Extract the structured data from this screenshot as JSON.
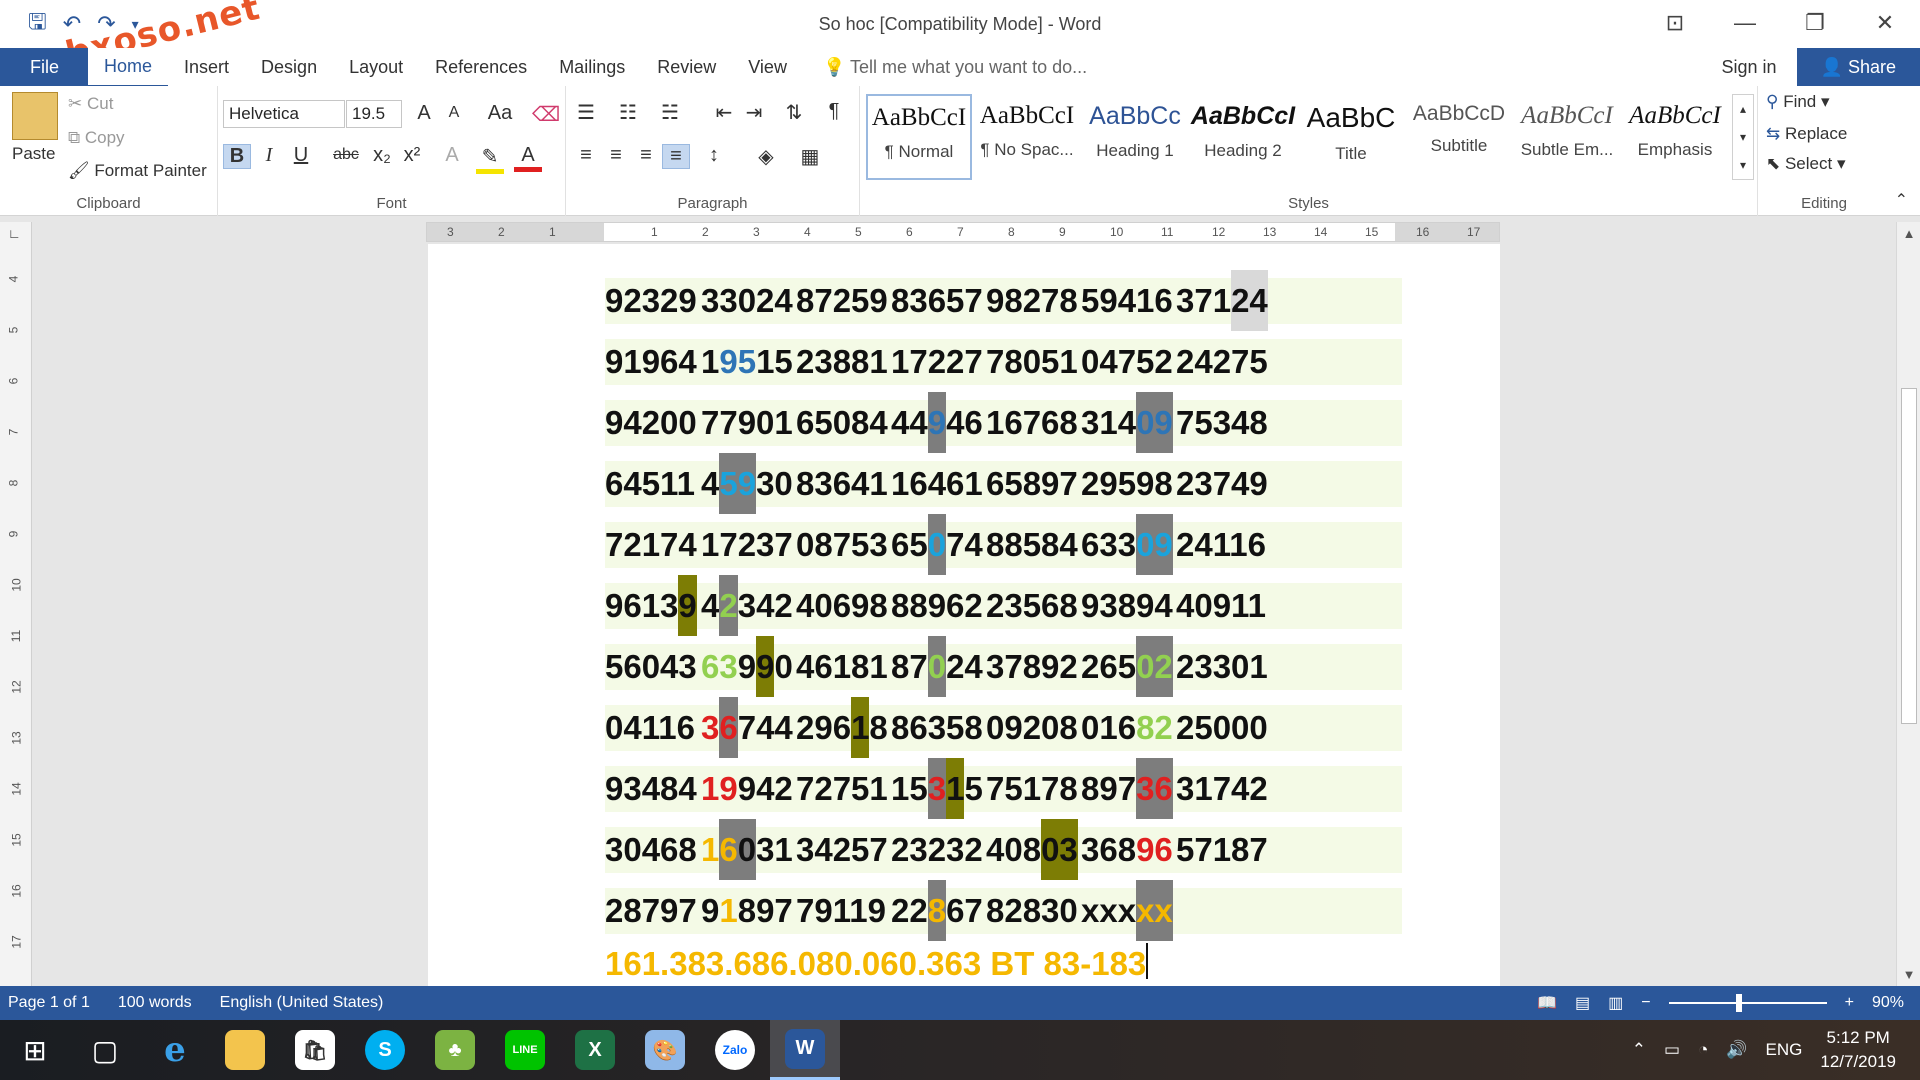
{
  "window": {
    "title": "So hoc [Compatibility Mode] - Word",
    "watermark": "webxoso.net",
    "controls": [
      "⊡",
      "—",
      "❐",
      "✕"
    ]
  },
  "ribbon_tabs": {
    "file": "File",
    "tabs": [
      "Home",
      "Insert",
      "Design",
      "Layout",
      "References",
      "Mailings",
      "Review",
      "View"
    ],
    "tell_me": "Tell me what you want to do...",
    "sign_in": "Sign in",
    "share": "Share"
  },
  "clipboard": {
    "paste": "Paste",
    "cut": "Cut",
    "copy": "Copy",
    "format_painter": "Format Painter",
    "label": "Clipboard"
  },
  "font": {
    "name": "Helvetica",
    "size": "19.5",
    "label": "Font",
    "bold": "B",
    "italic": "I",
    "underline": "U",
    "strike": "abc",
    "sub": "x₂",
    "sup": "x²",
    "case": "Aa"
  },
  "paragraph": {
    "label": "Paragraph",
    "pilcrow": "¶"
  },
  "styles": {
    "label": "Styles",
    "items": [
      {
        "sample": "AaBbCcI",
        "name": "¶ Normal"
      },
      {
        "sample": "AaBbCcI",
        "name": "¶ No Spac..."
      },
      {
        "sample": "AaBbCc",
        "name": "Heading 1"
      },
      {
        "sample": "AaBbCcI",
        "name": "Heading 2"
      },
      {
        "sample": "AaBbC",
        "name": "Title"
      },
      {
        "sample": "AaBbCcD",
        "name": "Subtitle"
      },
      {
        "sample": "AaBbCcI",
        "name": "Subtle Em..."
      },
      {
        "sample": "AaBbCcI",
        "name": "Emphasis"
      }
    ]
  },
  "editing": {
    "find": "Find",
    "replace": "Replace",
    "select": "Select",
    "label": "Editing"
  },
  "ruler": {
    "h_numbers": [
      "3",
      "2",
      "1",
      "",
      "1",
      "2",
      "3",
      "4",
      "5",
      "6",
      "7",
      "8",
      "9",
      "10",
      "11",
      "12",
      "13",
      "14",
      "15",
      "16",
      "17"
    ],
    "v_numbers": [
      "4",
      "5",
      "6",
      "7",
      "8",
      "9",
      "10",
      "11",
      "12",
      "13",
      "14",
      "15",
      "16",
      "17"
    ]
  },
  "document": {
    "rows": [
      [
        [
          [
            "92329",
            ""
          ]
        ],
        [
          [
            "33024",
            ""
          ]
        ],
        [
          [
            "87259",
            ""
          ]
        ],
        [
          [
            "83657",
            ""
          ]
        ],
        [
          [
            "98278",
            ""
          ]
        ],
        [
          [
            "59416",
            ""
          ]
        ],
        [
          [
            "371",
            ""
          ],
          [
            "2",
            "lt"
          ],
          [
            "4",
            "lt"
          ]
        ]
      ],
      [
        [
          [
            "91964",
            ""
          ]
        ],
        [
          [
            "1",
            ""
          ],
          [
            "95",
            "blue"
          ],
          [
            "15",
            ""
          ]
        ],
        [
          [
            "23881",
            ""
          ]
        ],
        [
          [
            "17227",
            ""
          ]
        ],
        [
          [
            "78051",
            ""
          ]
        ],
        [
          [
            "04752",
            ""
          ]
        ],
        [
          [
            "24275",
            ""
          ]
        ]
      ],
      [
        [
          [
            "94200",
            ""
          ]
        ],
        [
          [
            "77901",
            ""
          ]
        ],
        [
          [
            "65084",
            ""
          ]
        ],
        [
          [
            "44",
            ""
          ],
          [
            "9",
            "gray-blue"
          ],
          [
            "46",
            ""
          ]
        ],
        [
          [
            "16768",
            ""
          ]
        ],
        [
          [
            "314",
            ""
          ],
          [
            "09",
            "gray-blue"
          ]
        ],
        [
          [
            "75348",
            ""
          ]
        ]
      ],
      [
        [
          [
            "64511",
            ""
          ]
        ],
        [
          [
            "4",
            ""
          ],
          [
            "59",
            "gray-cyan"
          ],
          [
            "30",
            ""
          ]
        ],
        [
          [
            "83641",
            ""
          ]
        ],
        [
          [
            "16461",
            ""
          ]
        ],
        [
          [
            "65897",
            ""
          ]
        ],
        [
          [
            "29598",
            ""
          ]
        ],
        [
          [
            "23749",
            ""
          ]
        ]
      ],
      [
        [
          [
            "72174",
            ""
          ]
        ],
        [
          [
            "17237",
            ""
          ]
        ],
        [
          [
            "08753",
            ""
          ]
        ],
        [
          [
            "65",
            ""
          ],
          [
            "0",
            "gray-cyan"
          ],
          [
            "74",
            ""
          ]
        ],
        [
          [
            "88584",
            ""
          ]
        ],
        [
          [
            "633",
            ""
          ],
          [
            "09",
            "gray-cyan"
          ]
        ],
        [
          [
            "24116",
            ""
          ]
        ]
      ],
      [
        [
          [
            "9613",
            ""
          ],
          [
            "9",
            "olive"
          ]
        ],
        [
          [
            "4",
            ""
          ],
          [
            "2",
            "gray-green"
          ],
          [
            "342",
            ""
          ]
        ],
        [
          [
            "40698",
            ""
          ]
        ],
        [
          [
            "88962",
            ""
          ]
        ],
        [
          [
            "23568",
            ""
          ]
        ],
        [
          [
            "93894",
            ""
          ]
        ],
        [
          [
            "40911",
            ""
          ]
        ]
      ],
      [
        [
          [
            "56043",
            ""
          ]
        ],
        [
          [
            "63",
            "green"
          ],
          [
            "9",
            ""
          ],
          [
            "9",
            "olive"
          ],
          [
            "0",
            ""
          ]
        ],
        [
          [
            "46181",
            ""
          ]
        ],
        [
          [
            "87",
            ""
          ],
          [
            "0",
            "gray-green"
          ],
          [
            "24",
            ""
          ]
        ],
        [
          [
            "37892",
            ""
          ]
        ],
        [
          [
            "265",
            ""
          ],
          [
            "02",
            "gray-green"
          ]
        ],
        [
          [
            "23301",
            ""
          ]
        ]
      ],
      [
        [
          [
            "04116",
            ""
          ]
        ],
        [
          [
            "3",
            "red"
          ],
          [
            "6",
            "gray-red"
          ],
          [
            "744",
            ""
          ]
        ],
        [
          [
            "296",
            ""
          ],
          [
            "1",
            "olive"
          ],
          [
            "8",
            ""
          ]
        ],
        [
          [
            "86358",
            ""
          ]
        ],
        [
          [
            "09208",
            ""
          ]
        ],
        [
          [
            "016",
            ""
          ],
          [
            "82",
            "green"
          ]
        ],
        [
          [
            "25000",
            ""
          ]
        ]
      ],
      [
        [
          [
            "93484",
            ""
          ]
        ],
        [
          [
            "19",
            "red"
          ],
          [
            "942",
            ""
          ]
        ],
        [
          [
            "72751",
            ""
          ]
        ],
        [
          [
            "15",
            ""
          ],
          [
            "3",
            "gray-red"
          ],
          [
            "1",
            "olive"
          ],
          [
            "5",
            ""
          ]
        ],
        [
          [
            "75178",
            ""
          ]
        ],
        [
          [
            "897",
            ""
          ],
          [
            "36",
            "gray-red"
          ]
        ],
        [
          [
            "31742",
            ""
          ]
        ]
      ],
      [
        [
          [
            "30468",
            ""
          ]
        ],
        [
          [
            "1",
            "orange"
          ],
          [
            "6",
            "gray-orange"
          ],
          [
            "0",
            "gray"
          ],
          [
            "31",
            ""
          ]
        ],
        [
          [
            "34257",
            ""
          ]
        ],
        [
          [
            "23232",
            ""
          ]
        ],
        [
          [
            "408",
            ""
          ],
          [
            "03",
            "olive"
          ]
        ],
        [
          [
            "368",
            ""
          ],
          [
            "96",
            "red"
          ]
        ],
        [
          [
            "57187",
            ""
          ]
        ]
      ],
      [
        [
          [
            "28797",
            ""
          ]
        ],
        [
          [
            "9",
            ""
          ],
          [
            "1",
            "orange"
          ],
          [
            "897",
            ""
          ]
        ],
        [
          [
            "79119",
            ""
          ]
        ],
        [
          [
            "22",
            ""
          ],
          [
            "8",
            "gray-orange"
          ],
          [
            "67",
            ""
          ]
        ],
        [
          [
            "82830",
            ""
          ]
        ],
        [
          [
            "xxx",
            ""
          ],
          [
            "xx",
            "gray-orange"
          ]
        ],
        [
          [
            "",
            ""
          ]
        ]
      ]
    ],
    "footer_line": "161.383.686.080.060.363 BT 83-183"
  },
  "status": {
    "page": "Page 1 of 1",
    "words": "100 words",
    "language": "English (United States)",
    "zoom": "90%",
    "zoom_level": 0.9
  },
  "taskbar": {
    "apps": [
      "start",
      "task-view",
      "internet-explorer",
      "file-explorer",
      "store",
      "skype",
      "game",
      "line",
      "excel",
      "paint",
      "zalo",
      "word"
    ],
    "labels": {
      "skype": "S",
      "line": "LINE",
      "excel": "X",
      "zalo": "Zalo",
      "word": "W"
    },
    "lang": "ENG",
    "time": "5:12 PM",
    "date": "12/7/2019"
  },
  "colors": {
    "accent": "#2b579a",
    "row_band": "#f4fae6",
    "highlight_gray": "#7d7d7d",
    "highlight_olive": "#7d7d05",
    "blue": "#2e75b6",
    "cyan": "#1aa3dc",
    "green": "#92d050",
    "red": "#e02020",
    "orange": "#f5b800"
  }
}
